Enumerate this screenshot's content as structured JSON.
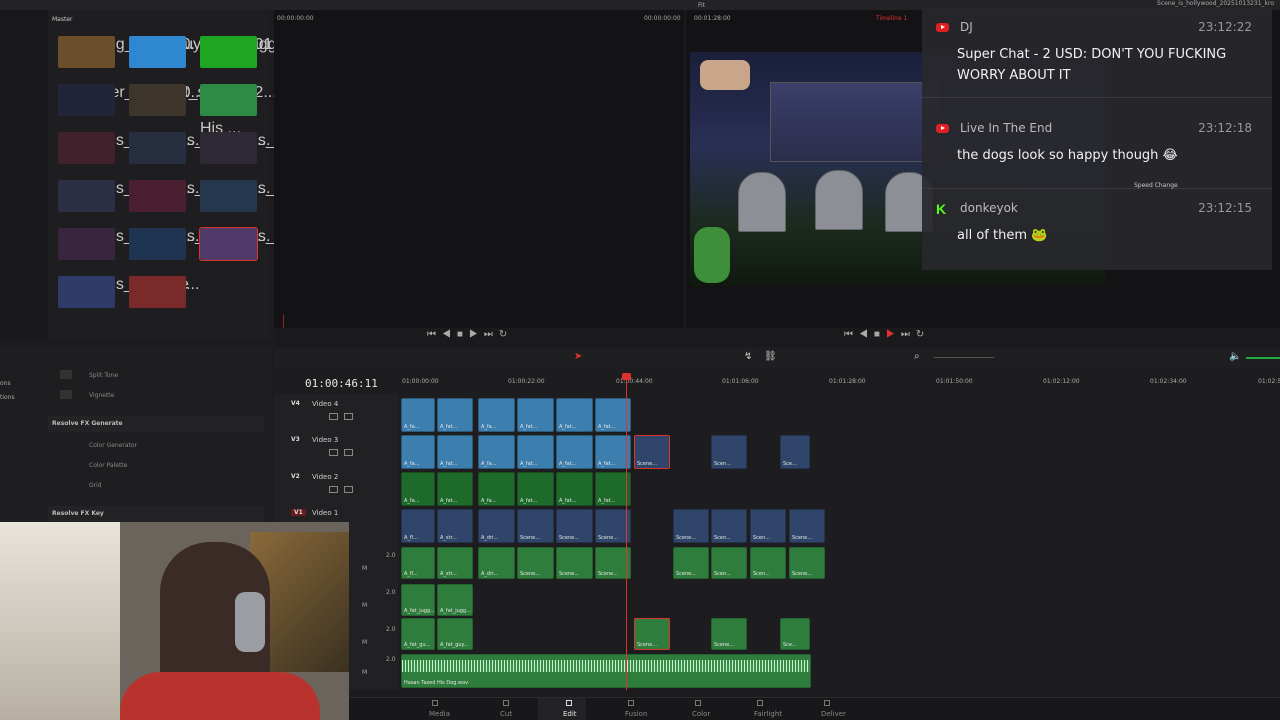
{
  "window": {
    "title": "Scene_is_hollywood_20251013231_kro",
    "src_timecode_left": "00:00:00:00",
    "src_timecode_right": "00:00:00:00",
    "prg_timecode": "00:01:28:00",
    "timeline_name": "Timeline 1",
    "fit_label": "Fit"
  },
  "media_pool": {
    "title": "Master",
    "clips": [
      {
        "label": "A_driving_shot_20...",
        "color": "#6b4e2a"
      },
      {
        "label": "A_fat_guy_2025101...",
        "color": "#2f88cf"
      },
      {
        "label": "A_fat_juggalo_2025...",
        "color": "#1fa51f"
      },
      {
        "label": "A_flyover_shot_20...",
        "color": "#20253a"
      },
      {
        "label": "A_street_shot_202...",
        "color": "#3d342c"
      },
      {
        "label": "Hasan Tazed His ...",
        "color": "#2e8b47"
      },
      {
        "label": "Scene_is_hollywo...",
        "color": "#40212c"
      },
      {
        "label": "Scene_is_hollywo...",
        "color": "#262e3f"
      },
      {
        "label": "Scene_is_hollywo...",
        "color": "#2f2835"
      },
      {
        "label": "Scene_is_hollywo...",
        "color": "#2b2f45"
      },
      {
        "label": "Scene_is_hollywo...",
        "color": "#4a2030"
      },
      {
        "label": "Scene_is_hollywo...",
        "color": "#263850"
      },
      {
        "label": "Scene_is_hollywo...",
        "color": "#382540"
      },
      {
        "label": "Scene_is_hollywo...",
        "color": "#1f3450"
      },
      {
        "label": "Scene_is_hollywo...",
        "color": "#503a6a"
      },
      {
        "label": "Scene_is_hollywo...",
        "color": "#2d3b66"
      },
      {
        "label": "Timeline 1",
        "color": "#7a2a28"
      }
    ]
  },
  "effects": {
    "items_top": [
      "Split Tone",
      "Vignette"
    ],
    "section_generate": "Resolve FX Generate",
    "generate_items": [
      "Color Generator",
      "Color Palette",
      "Grid"
    ],
    "section_key": "Resolve FX Key",
    "side_labels": [
      "ons",
      "tions"
    ]
  },
  "chat": {
    "messages": [
      {
        "platform": "youtube",
        "name": "DJ",
        "time": "23:12:22",
        "text": "Super Chat - 2 USD: DON'T YOU FUCKING WORRY ABOUT IT"
      },
      {
        "platform": "youtube",
        "name": "Live In The End",
        "time": "23:12:18",
        "text": "the dogs look so happy though 😂"
      },
      {
        "platform": "kick",
        "name": "donkeyok",
        "time": "23:12:15",
        "text": "all of them 🐸"
      }
    ],
    "behind_label": "Speed Change"
  },
  "timeline": {
    "timecode": "01:00:46:11",
    "ruler": [
      "01:00:00:00",
      "01:00:22:00",
      "01:00:44:00",
      "01:01:06:00",
      "01:01:28:00",
      "01:01:50:00",
      "01:02:12:00",
      "01:02:34:00",
      "01:02:5"
    ],
    "tracks": [
      {
        "id": "V4",
        "name": "Video 4"
      },
      {
        "id": "V3",
        "name": "Video 3"
      },
      {
        "id": "V2",
        "name": "Video 2"
      },
      {
        "id": "V1",
        "name": "Video 1"
      }
    ],
    "audio_levels": [
      "2.0",
      "2.0",
      "2.0",
      "2.0"
    ],
    "audio_mute": "M",
    "audio_file": "Hasan Tazed His Dog.wav",
    "labels": {
      "v4": [
        "A_fa...",
        "A_fat...",
        "A_fa...",
        "A_fat...",
        "A_fat...",
        "A_fat...",
        "A_fat..."
      ],
      "v3": [
        "A_fa...",
        "A_fat...",
        "A_fa...",
        "A_fat...",
        "A_fat...",
        "A_fat...",
        "Scene...",
        "Scen...",
        "Sce..."
      ],
      "v2": [
        "A_fa...",
        "A_fat...",
        "A_fa...",
        "A_fat...",
        "A_fat...",
        "A_fat..."
      ],
      "v1": [
        "A_fl...",
        "A_str...",
        "A_dri...",
        "Scene...",
        "Scene...",
        "Scene...",
        "Scene...",
        "Scen...",
        "Scen...",
        "Scene..."
      ],
      "a1": [
        "A_fl...",
        "A_str...",
        "A_dri...",
        "Scene...",
        "Scene...",
        "Scene...",
        "Scene...",
        "Scen...",
        "Scen...",
        "Scene..."
      ],
      "a2": [
        "A_fat_jugg...",
        "A_fat_jugg..."
      ],
      "a3": [
        "A_fat_gu...",
        "A_fat_guy...",
        "Scene...",
        "Scene...",
        "Sce..."
      ]
    }
  },
  "bottom_nav": [
    "Media",
    "Cut",
    "Edit",
    "Fusion",
    "Color",
    "Fairlight",
    "Deliver"
  ],
  "active_page": "Edit",
  "colors": {
    "accent": "#e0322c",
    "clip_blue": "#3c7fae",
    "clip_green": "#1e6a2a",
    "audio_green": "#2f7d3c"
  }
}
